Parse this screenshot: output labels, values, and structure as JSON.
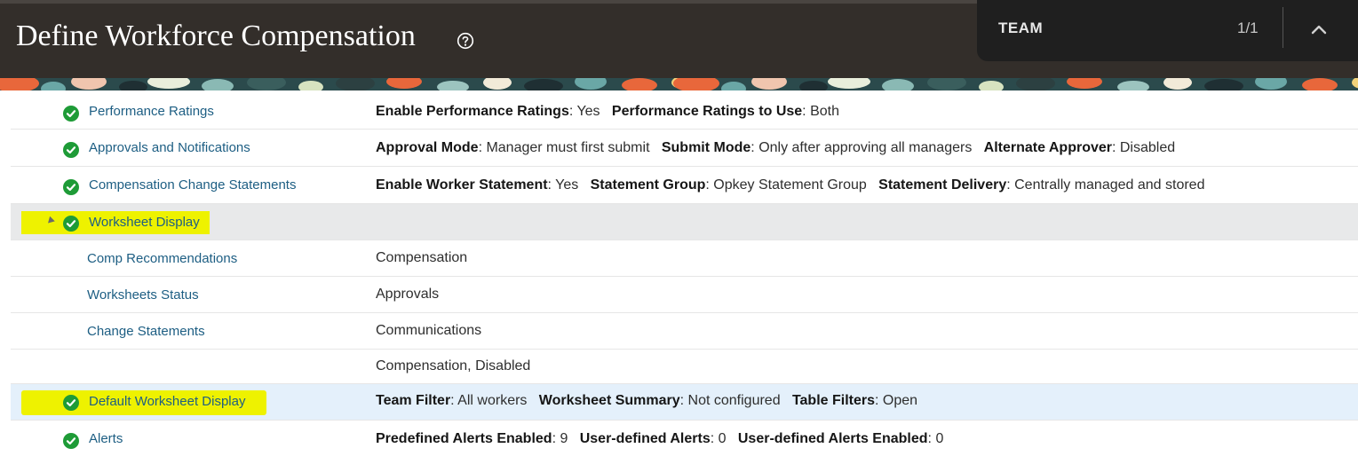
{
  "page": {
    "title": "Define Workforce Compensation"
  },
  "find_bar": {
    "term": "TEAM",
    "count": "1/1"
  },
  "rows": [
    {
      "label": "Performance Ratings",
      "details": [
        {
          "k": "Enable Performance Ratings",
          "v": ": Yes"
        },
        {
          "k": "Performance Ratings to Use",
          "v": ": Both"
        }
      ]
    },
    {
      "label": "Approvals and Notifications",
      "details": [
        {
          "k": "Approval Mode",
          "v": ": Manager must first submit"
        },
        {
          "k": "Submit Mode",
          "v": ": Only after approving all managers"
        },
        {
          "k": "Alternate Approver",
          "v": ": Disabled"
        }
      ]
    },
    {
      "label": "Compensation Change Statements",
      "details": [
        {
          "k": "Enable Worker Statement",
          "v": ": Yes"
        },
        {
          "k": "Statement Group",
          "v": ": Opkey Statement Group"
        },
        {
          "k": "Statement Delivery",
          "v": ": Centrally managed and stored"
        }
      ]
    },
    {
      "label": "Worksheet Display"
    },
    {
      "label": "Comp Recommendations",
      "value": "Compensation"
    },
    {
      "label": "Worksheets Status",
      "value": "Approvals"
    },
    {
      "label": "Change Statements",
      "value": "Communications"
    },
    {
      "label": "",
      "value": "Compensation, Disabled"
    },
    {
      "label": "Default Worksheet Display",
      "details": [
        {
          "k": "Team Filter",
          "v": ": All workers"
        },
        {
          "k": "Worksheet Summary",
          "v": ": Not configured"
        },
        {
          "k": "Table Filters",
          "v": ": Open"
        }
      ]
    },
    {
      "label": "Alerts",
      "details": [
        {
          "k": "Predefined Alerts Enabled",
          "v": ": 9"
        },
        {
          "k": "User-defined Alerts",
          "v": ": 0"
        },
        {
          "k": "User-defined Alerts Enabled",
          "v": ": 0"
        }
      ]
    }
  ],
  "colors": {
    "header": "#332e2a",
    "link": "#1d5e83",
    "check": "#1e9b37",
    "highlight": "#eef200",
    "selected_row": "#e8e9ea",
    "hover_row": "#e4f0fb"
  }
}
